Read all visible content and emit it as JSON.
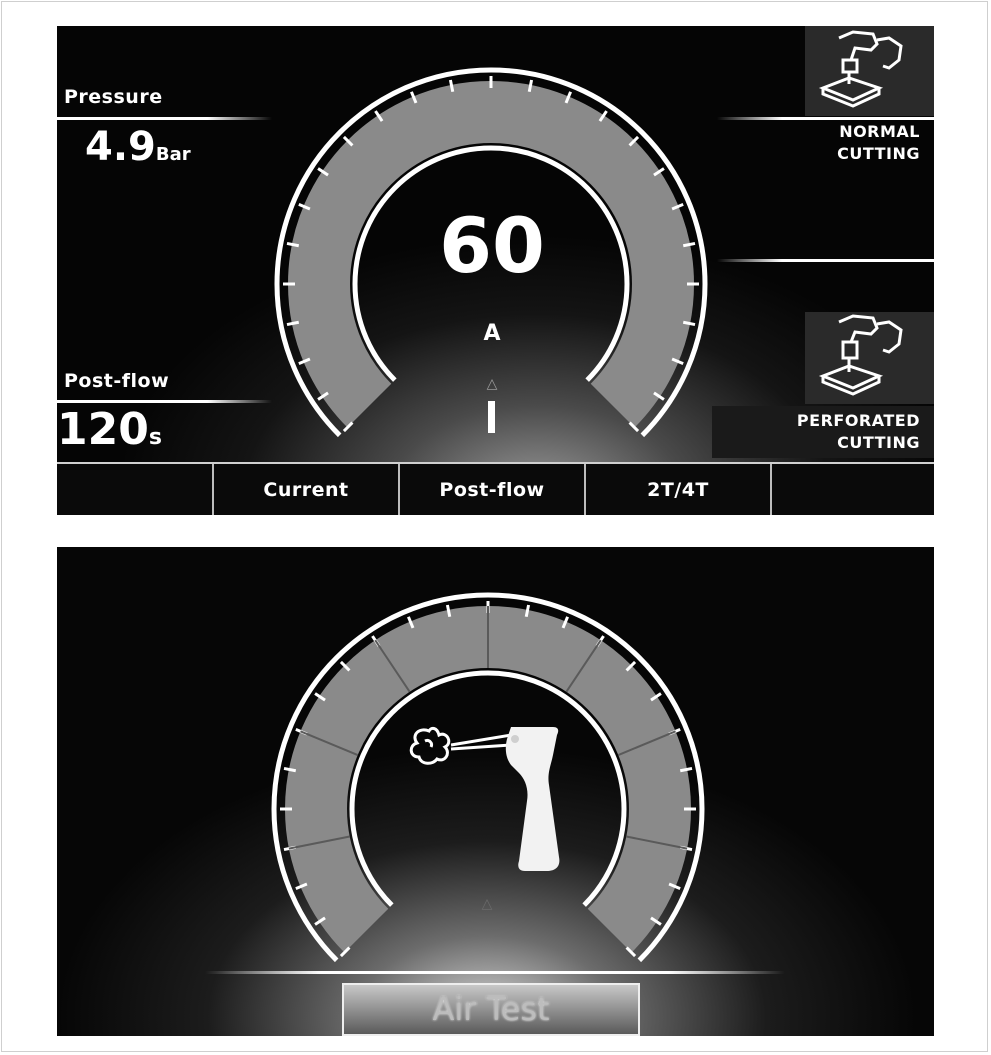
{
  "screen1": {
    "pressure": {
      "label": "Pressure",
      "value": "4.9",
      "unit": "Bar"
    },
    "postflow": {
      "label": "Post-flow",
      "value": "120",
      "unit": "s"
    },
    "current": {
      "value": "60",
      "unit": "A"
    },
    "modes": [
      {
        "line1": "NORMAL",
        "line2": "CUTTING",
        "icon": "normal-cutting-torch-icon"
      },
      {
        "line1": "PERFORATED",
        "line2": "CUTTING",
        "icon": "perforated-cutting-torch-icon"
      }
    ],
    "tabs": [
      "Current",
      "Post-flow",
      "2T/4T"
    ]
  },
  "screen2": {
    "icon": "air-test-torch-icon",
    "button_label": "Air Test"
  },
  "colors": {
    "foreground": "#ffffff",
    "gauge_fill": "#8a8a8a",
    "background": "#0a0a0a"
  }
}
